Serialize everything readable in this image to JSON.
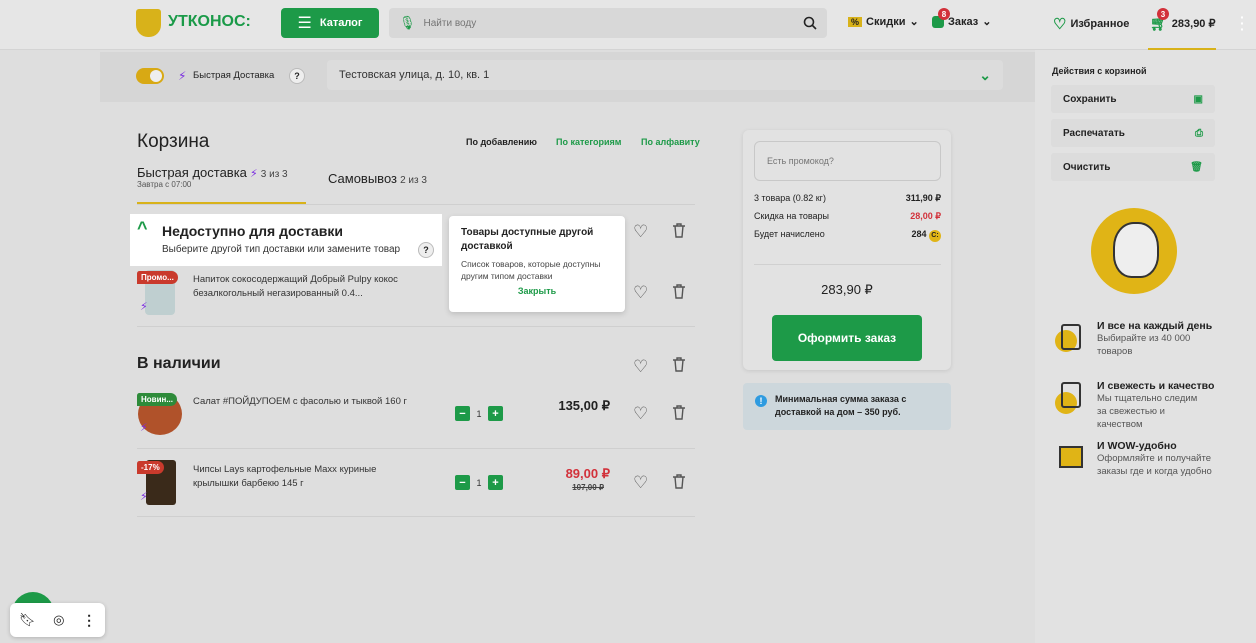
{
  "header": {
    "logo": "УТКОНОС:",
    "catalog": "Каталог",
    "search_placeholder": "Найти воду",
    "discounts": "Скидки",
    "discount_icon": "%",
    "orders": "Заказ",
    "orders_badge": "8",
    "favorites": "Избранное",
    "cart_badge": "3",
    "cart_total": "283,90 ₽"
  },
  "subbar": {
    "fast_delivery": "Быстрая Доставка",
    "help": "?",
    "address": "Тестовская улица, д. 10, кв. 1"
  },
  "cart": {
    "title": "Корзина",
    "sort": [
      "По добавлению",
      "По категориям",
      "По алфавиту"
    ],
    "tabs": [
      {
        "label": "Быстрая доставка",
        "count": "3 из 3",
        "sub": "Завтра с 07:00"
      },
      {
        "label": "Самовывоз",
        "count": "2 из 3"
      }
    ],
    "unavailable": {
      "title": "Недоступно для доставки",
      "subtitle": "Выберите другой тип доставки или замените товар",
      "help": "?"
    },
    "tooltip": {
      "title": "Товары доступные другой доставкой",
      "text": "Список товаров, которые доступны другим типом доставки",
      "close": "Закрыть"
    },
    "unavailable_items": [
      {
        "tag": "Промо...",
        "name": "Напиток сокосодержащий Добрый Pulpy кокос безалкогольный негазированный 0.4..."
      }
    ],
    "in_stock_title": "В наличии",
    "items": [
      {
        "tag": "Новин...",
        "name": "Салат #ПОЙДУПОЕМ с фасолью и тыквой 160 г",
        "qty": "1",
        "price": "135,00 ₽",
        "old_price": ""
      },
      {
        "tag": "-17%",
        "name": "Чипсы Lays картофельные Maxx куриные крылышки барбекю 145 г",
        "qty": "1",
        "price": "89,00 ₽",
        "old_price": "107,00 ₽"
      }
    ],
    "minus": "−",
    "plus": "+"
  },
  "summary": {
    "promo_placeholder": "Есть промокод?",
    "rows": [
      {
        "label": "3 товара (0.82 кг)",
        "value": "311,90 ₽"
      },
      {
        "label": "Скидка на товары",
        "value": "28,00 ₽"
      },
      {
        "label": "Будет начислено",
        "value": "284"
      }
    ],
    "bonus_icon": "C:",
    "total": "283,90 ₽",
    "checkout": "Оформить заказ",
    "info": "Минимальная сумма заказа с доставкой на дом – 350 руб."
  },
  "actions": {
    "title": "Действия с корзиной",
    "items": [
      "Сохранить",
      "Распечатать",
      "Очистить"
    ]
  },
  "features": [
    {
      "title": "И все на каждый день",
      "text": "Выбирайте из 40 000 товаров"
    },
    {
      "title": "И свежесть и качество",
      "text": "Мы тщательно следим за свежестью и качеством"
    },
    {
      "title": "И WOW-удобно",
      "text": "Оформляйте и получайте заказы где и когда удобно"
    }
  ],
  "colors": {
    "green": "#1d9a48",
    "yellow": "#d8b21a",
    "red": "#d2313a",
    "purple": "#7b2ee0"
  }
}
